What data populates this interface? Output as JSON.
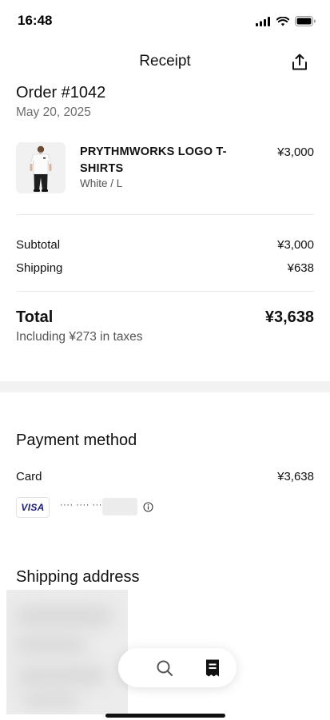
{
  "status_bar": {
    "time": "16:48"
  },
  "header": {
    "title": "Receipt",
    "share_icon": "share-icon"
  },
  "order": {
    "title": "Order #1042",
    "date": "May 20, 2025"
  },
  "item": {
    "name": "PRYTHMWORKS LOGO T-SHIRTS",
    "variant": "White / L",
    "price": "¥3,000"
  },
  "summary": {
    "subtotal_label": "Subtotal",
    "subtotal_value": "¥3,000",
    "shipping_label": "Shipping",
    "shipping_value": "¥638",
    "total_label": "Total",
    "total_value": "¥3,638",
    "tax_note": "Including ¥273 in taxes"
  },
  "payment": {
    "title": "Payment method",
    "card_label": "Card",
    "card_amount": "¥3,638",
    "brand": "VISA",
    "masked_number": "···· ···· ···"
  },
  "shipping_address": {
    "title": "Shipping address"
  },
  "tabbar": {
    "items": [
      "search-icon",
      "receipt-icon"
    ]
  },
  "colors": {
    "visa_blue": "#1a1f71",
    "band_gray": "#f2f2f2",
    "muted_text": "#6e6e6e"
  }
}
